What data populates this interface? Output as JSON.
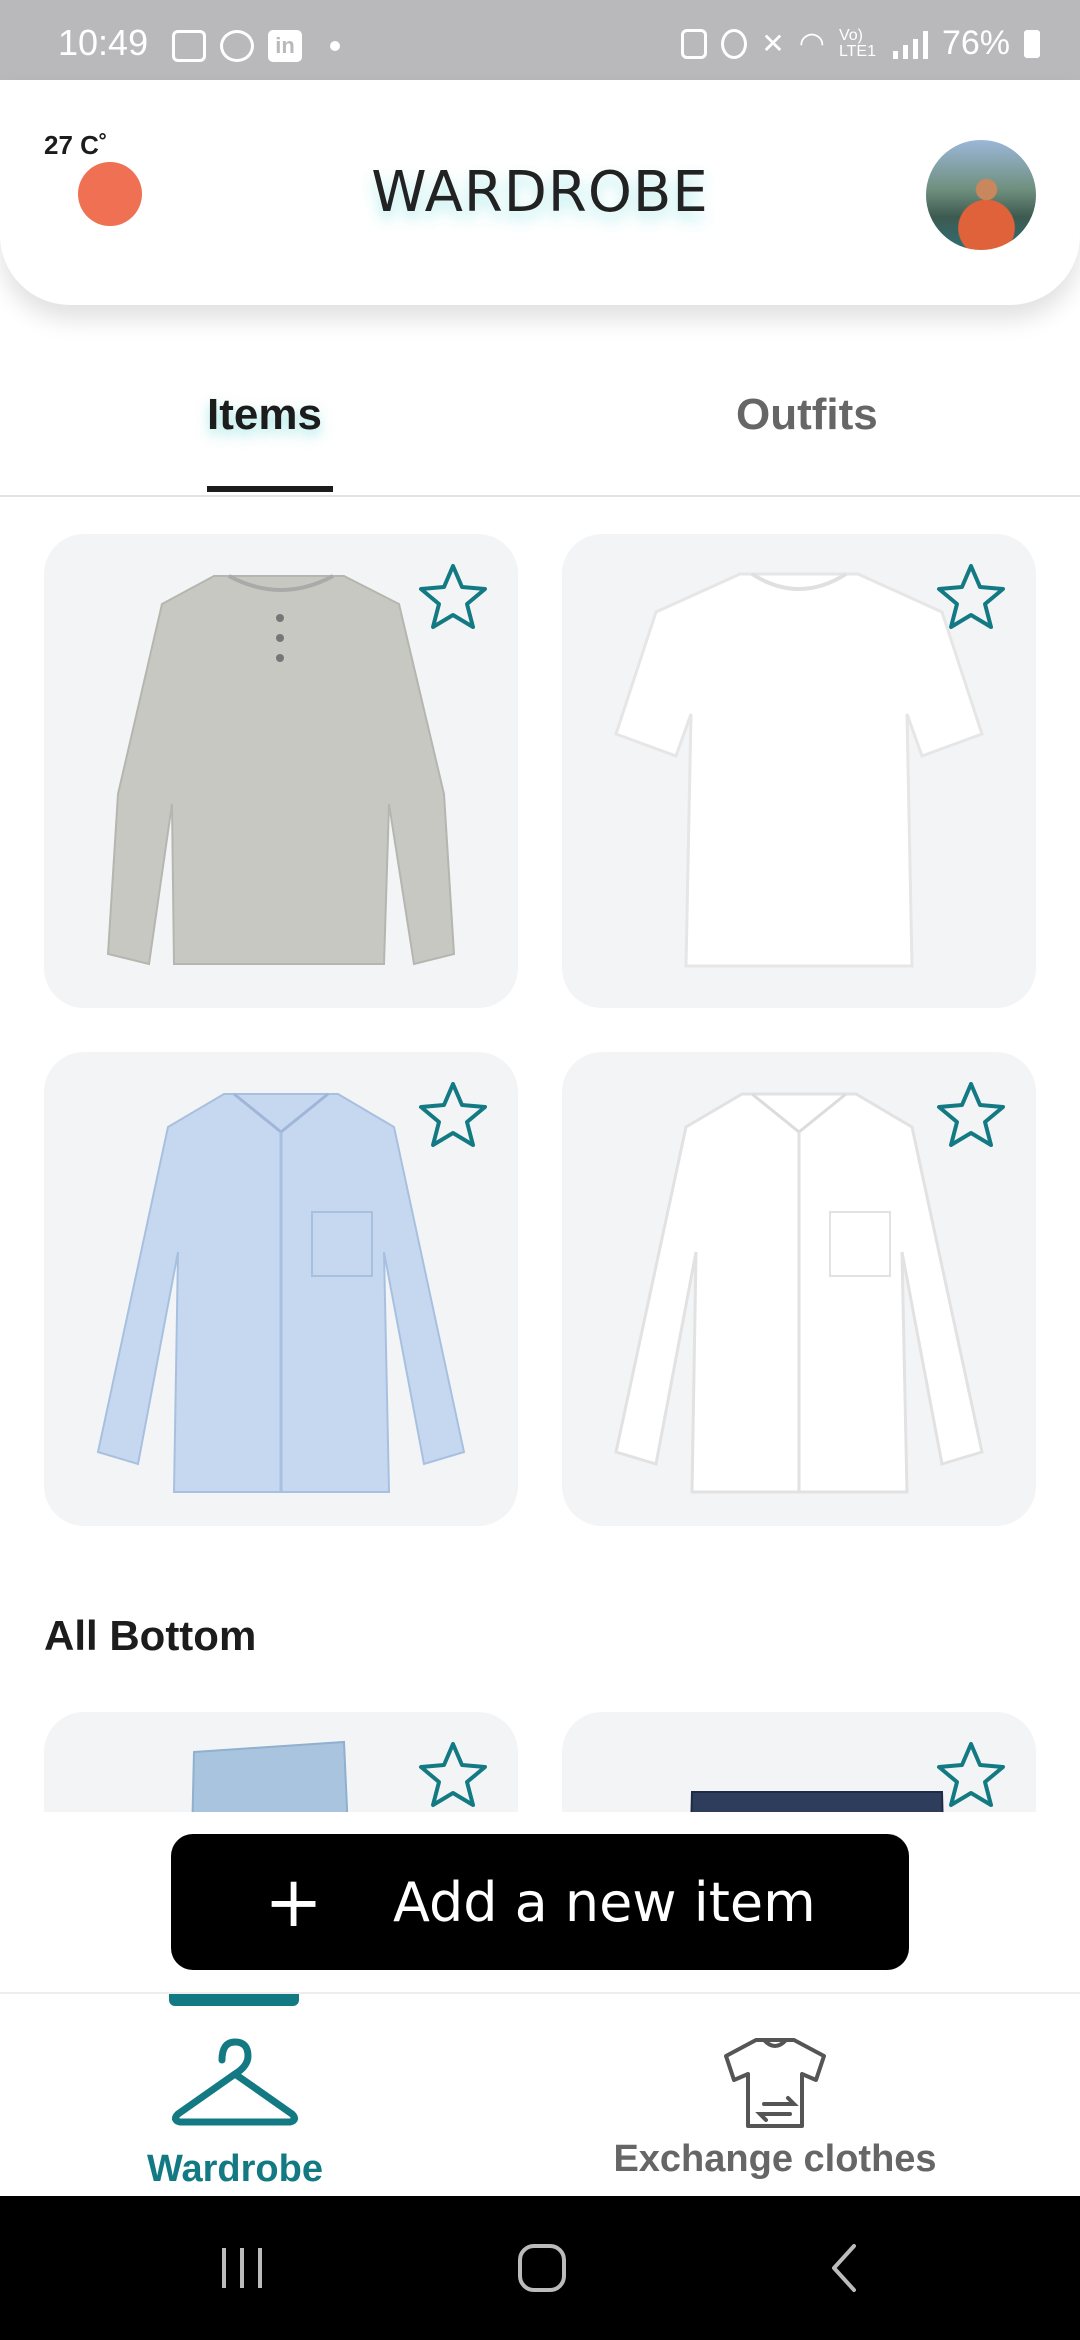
{
  "status_bar": {
    "time": "10:49",
    "network_label": "Vo) LTE1",
    "battery": "76%"
  },
  "header": {
    "temperature": "27 C˚",
    "title": "WARDROBE",
    "weather_color": "#ef7052"
  },
  "tabs": [
    {
      "label": "Items",
      "active": true
    },
    {
      "label": "Outfits",
      "active": false
    }
  ],
  "items": [
    {
      "name": "grey-henley-icon",
      "favorite": false
    },
    {
      "name": "white-tshirt-icon",
      "favorite": false
    },
    {
      "name": "blue-oxford-shirt-icon",
      "favorite": false
    },
    {
      "name": "white-oxford-shirt-icon",
      "favorite": false
    }
  ],
  "section_bottom": {
    "title": "All Bottom",
    "items": [
      {
        "name": "light-jeans-icon",
        "favorite": false
      },
      {
        "name": "dark-jeans-icon",
        "favorite": false
      }
    ]
  },
  "add_button": {
    "icon": "plus-icon",
    "label": "Add a new item"
  },
  "bottom_nav": [
    {
      "label": "Wardrobe",
      "icon": "hanger-icon",
      "active": true
    },
    {
      "label": "Exchange clothes",
      "icon": "tshirt-exchange-icon",
      "active": false
    }
  ],
  "colors": {
    "accent": "#137a84",
    "card_bg": "#f3f4f6",
    "button_bg": "#000000"
  }
}
